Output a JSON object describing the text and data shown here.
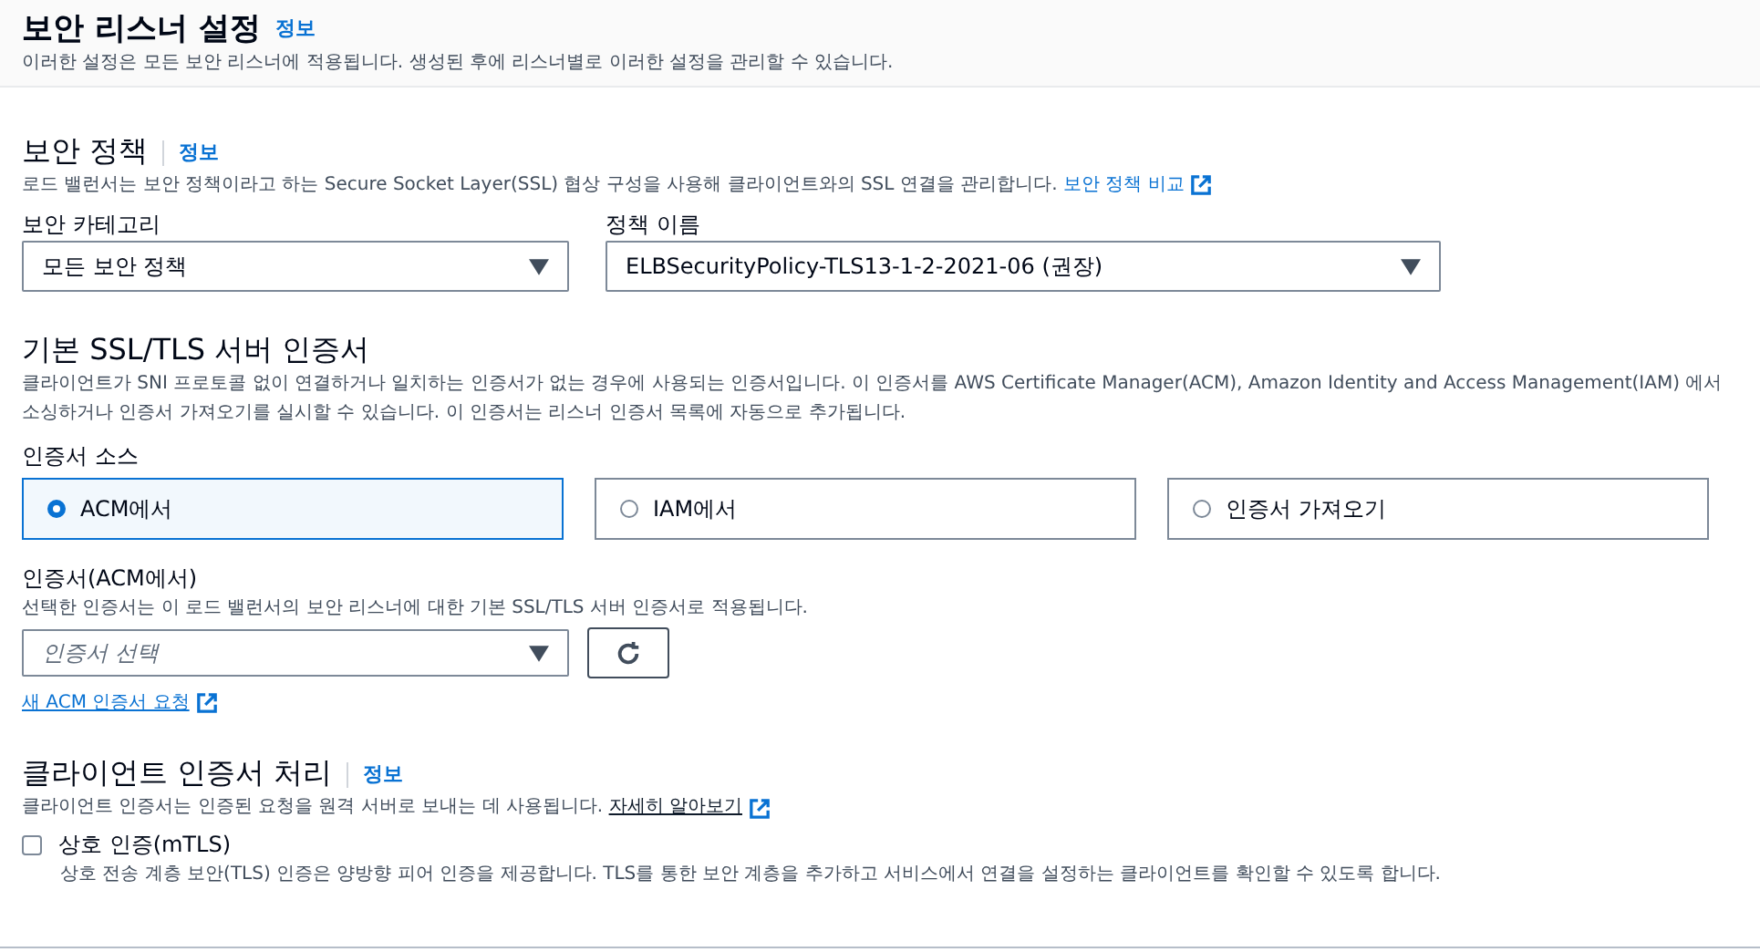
{
  "header": {
    "title": "보안 리스너 설정",
    "info": "정보",
    "description": "이러한 설정은 모든 보안 리스너에 적용됩니다. 생성된 후에 리스너별로 이러한 설정을 관리할 수 있습니다."
  },
  "security_policy": {
    "title": "보안 정책",
    "info": "정보",
    "description": "로드 밸런서는 보안 정책이라고 하는 Secure Socket Layer(SSL) 협상 구성을 사용해 클라이언트와의 SSL 연결을 관리합니다.",
    "link": "보안 정책 비교",
    "fields": [
      {
        "label": "보안 카테고리",
        "value": "모든 보안 정책"
      },
      {
        "label": "정책 이름",
        "value": "ELBSecurityPolicy-TLS13-1-2-2021-06 (권장)"
      }
    ]
  },
  "certificate": {
    "title": "기본 SSL/TLS 서버 인증서",
    "description": "클라이언트가 SNI 프로토콜 없이 연결하거나 일치하는 인증서가 없는 경우에 사용되는 인증서입니다. 이 인증서를 AWS Certificate Manager(ACM), Amazon Identity and Access Management(IAM) 에서 소싱하거나 인증서 가져오기를 실시할 수 있습니다. 이 인증서는 리스너 인증서 목록에 자동으로 추가됩니다.",
    "source_label": "인증서 소스",
    "sources": [
      {
        "label": "ACM에서",
        "selected": true
      },
      {
        "label": "IAM에서",
        "selected": false
      },
      {
        "label": "인증서 가져오기",
        "selected": false
      }
    ],
    "cert_label": "인증서(ACM에서)",
    "cert_description": "선택한 인증서는 이 로드 밸런서의 보안 리스너에 대한 기본 SSL/TLS 서버 인증서로 적용됩니다.",
    "cert_select": {
      "placeholder": "인증서 선택"
    },
    "request_link": "새 ACM 인증서 요청"
  },
  "client_cert": {
    "title": "클라이언트 인증서 처리",
    "info": "정보",
    "description": "클라이언트 인증서는 인증된 요청을 원격 서버로 보내는 데 사용됩니다.",
    "link": "자세히 알아보기",
    "option": {
      "label": "상호 인증(mTLS)",
      "checked": false,
      "description": "상호 전송 계층 보안(TLS) 인증은 양방향 피어 인증을 제공합니다. TLS를 통한 보안 계층을 추가하고 서비스에서 연결을 설정하는 클라이언트를 확인할 수 있도록 합니다."
    }
  }
}
